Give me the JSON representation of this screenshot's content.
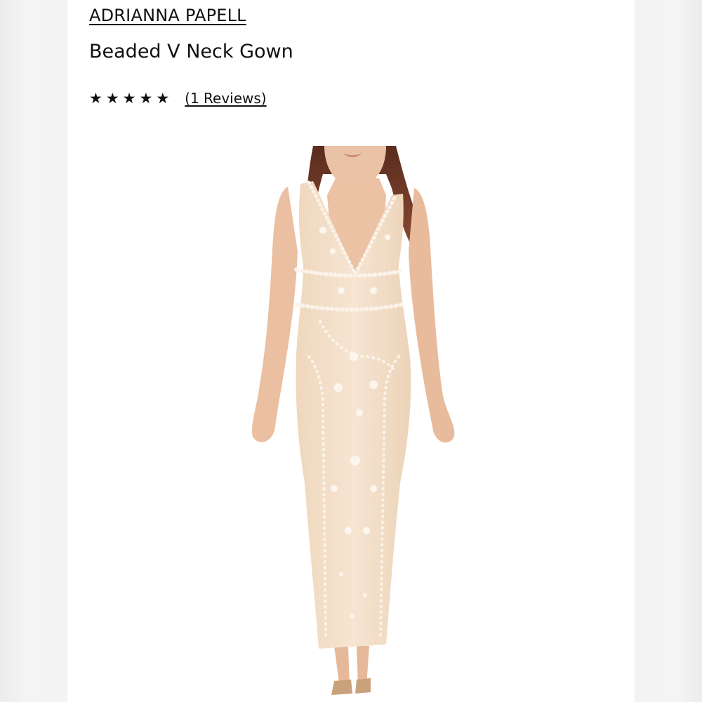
{
  "product": {
    "brand": "ADRIANNA PAPELL",
    "name": "Beaded V Neck Gown",
    "rating": {
      "stars": [
        "★",
        "★",
        "★",
        "★",
        "★"
      ],
      "value": 5,
      "max": 5,
      "reviews_label": "(1 Reviews)"
    }
  },
  "colors": {
    "page_background": "#f1f1f1",
    "card_background": "#ffffff",
    "text": "#111111",
    "gown": "#f3dfc8",
    "gown_beading": "#fbf3ea",
    "skin": "#ecc2a5",
    "hair": "#6b3626"
  },
  "icons": {
    "star": "star-icon"
  }
}
